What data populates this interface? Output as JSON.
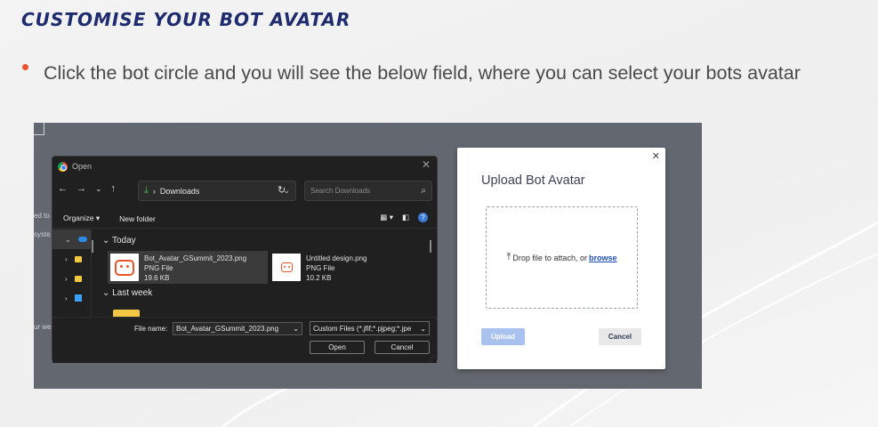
{
  "slide": {
    "heading": "CUSTOMISE YOUR BOT AVATAR",
    "bullet": "Click the bot circle and you will see the below field, where you can select your bots avatar"
  },
  "accent_color": "#e8552c",
  "heading_color": "#1e2b6e",
  "screenshot": {
    "bg_fragments": [
      "ed to",
      "syste",
      "ur we"
    ],
    "file_dialog": {
      "title": "Open",
      "address": "Downloads",
      "search_placeholder": "Search Downloads",
      "toolbar": {
        "organize": "Organize",
        "new_folder": "New folder"
      },
      "groups": [
        {
          "label": "Today",
          "files": [
            {
              "name": "Bot_Avatar_GSummit_2023.png",
              "type": "PNG File",
              "size": "19.6 KB",
              "selected": true
            },
            {
              "name": "Untitled design.png",
              "type": "PNG File",
              "size": "10.2 KB",
              "selected": false
            }
          ]
        },
        {
          "label": "Last week"
        }
      ],
      "file_name_label": "File name:",
      "file_name_value": "Bot_Avatar_GSummit_2023.png",
      "file_type": "Custom Files (*.jfif;*.pjpeg;*.jpe",
      "open_button": "Open",
      "cancel_button": "Cancel"
    },
    "upload_modal": {
      "title": "Upload Bot Avatar",
      "drop_text": "Drop file to attach, or",
      "browse": "browse",
      "upload_button": "Upload",
      "cancel_button": "Cancel"
    }
  }
}
